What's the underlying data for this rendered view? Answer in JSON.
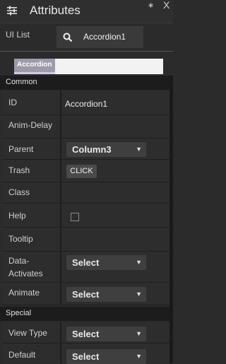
{
  "header": {
    "title": "Attributes",
    "pin_glyph": "∗",
    "close_glyph": "X"
  },
  "ui_list": {
    "label": "UI List",
    "search_value": "Accordion1"
  },
  "tabs": {
    "active_label": "Accordion"
  },
  "sections": {
    "common": "Common",
    "special": "Special"
  },
  "rows": {
    "id": {
      "label": "ID",
      "value": "Accordion1"
    },
    "anim_delay": {
      "label": "Anim-Delay",
      "value": ""
    },
    "parent": {
      "label": "Parent",
      "value": "Column3"
    },
    "trash": {
      "label": "Trash",
      "button": "CLICK"
    },
    "class": {
      "label": "Class",
      "value": ""
    },
    "help": {
      "label": "Help",
      "checked": false
    },
    "tooltip": {
      "label": "Tooltip",
      "value": ""
    },
    "data_activates": {
      "label_line1": "Data-",
      "label_line2": "Activates",
      "value": "Select"
    },
    "animate": {
      "label": "Animate",
      "value": "Select"
    },
    "view_type": {
      "label": "View Type",
      "value": "Select"
    },
    "default": {
      "label": "Default",
      "value": "Select"
    }
  },
  "icons": {
    "menu": "sliders-icon",
    "search": "search-icon",
    "pin": "pin-icon",
    "close": "close-icon",
    "caret": "caret-down-icon"
  },
  "colors": {
    "background": "#2b2b2b",
    "section_header": "#1c1c1c",
    "tab_active": "#9e9aa8",
    "select_bg": "#3f3f3f"
  }
}
